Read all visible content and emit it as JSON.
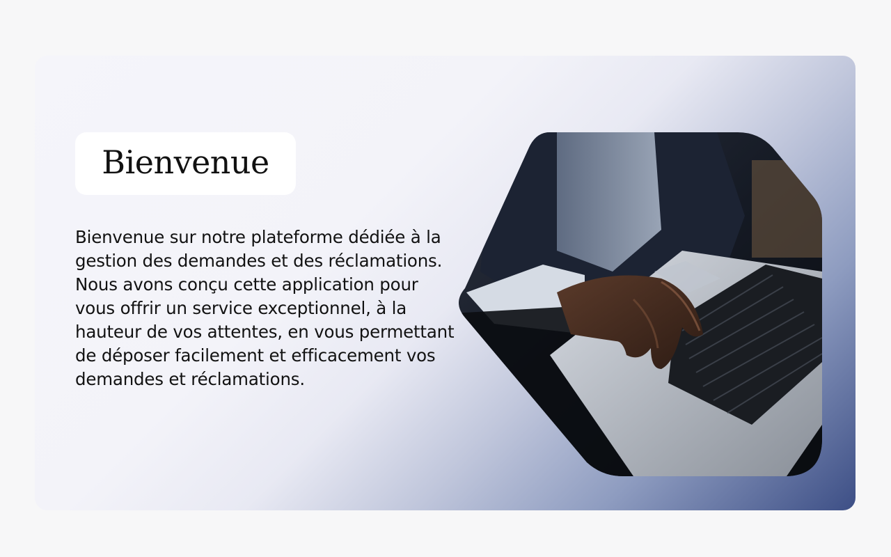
{
  "card": {
    "title": "Bienvenue",
    "description": "Bienvenue sur notre plateforme dédiée à la gestion des demandes et des réclamations. Nous avons conçu cette application pour vous offrir un service exceptionnel, à la hauteur de vos attentes, en vous permettant de déposer facilement et efficacement vos demandes et réclamations."
  },
  "image": {
    "icon": "laptop-typing-photo"
  },
  "colors": {
    "page_background": "#f7f7f8",
    "card_gradient_start": "#f5f5fa",
    "card_gradient_end": "#3d4f86",
    "text": "#121212"
  }
}
